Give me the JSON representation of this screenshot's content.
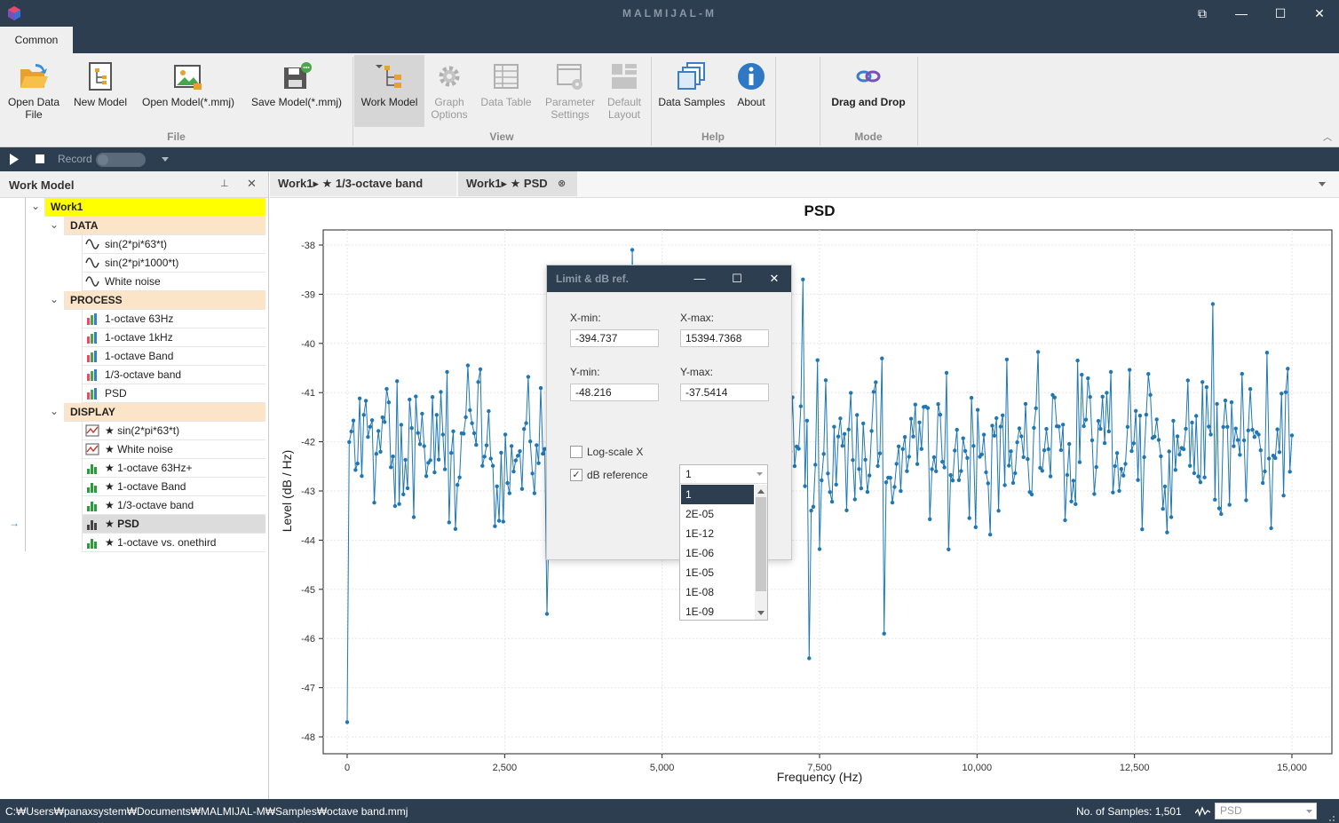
{
  "window": {
    "title": "MALMIJAL-M",
    "controls": {
      "restore_docked": "⧉",
      "minimize": "—",
      "maximize": "☐",
      "close": "✕"
    }
  },
  "ribbon": {
    "tab": "Common",
    "groups": {
      "file": {
        "label": "File",
        "buttons": [
          {
            "label": "Open Data\nFile",
            "icon": "folder-open-icon"
          },
          {
            "label": "New Model",
            "icon": "new-model-icon"
          },
          {
            "label": "Open Model(*.mmj)",
            "icon": "open-model-icon"
          },
          {
            "label": "Save Model(*.mmj)",
            "icon": "save-model-icon"
          }
        ]
      },
      "view": {
        "label": "View",
        "buttons": [
          {
            "label": "Work Model",
            "icon": "tree-icon",
            "active": true
          },
          {
            "label": "Graph\nOptions",
            "icon": "gear-icon",
            "disabled": true
          },
          {
            "label": "Data Table",
            "icon": "table-icon",
            "disabled": true
          },
          {
            "label": "Parameter\nSettings",
            "icon": "settings-window-icon",
            "disabled": true
          },
          {
            "label": "Default\nLayout",
            "icon": "layout-icon",
            "disabled": true
          }
        ]
      },
      "help": {
        "label": "Help",
        "buttons": [
          {
            "label": "Data Samples",
            "icon": "samples-icon"
          },
          {
            "label": "About",
            "icon": "info-icon"
          }
        ]
      },
      "mode": {
        "label": "Mode",
        "buttons": [
          {
            "label": "Drag and Drop",
            "icon": "drag-drop-icon"
          }
        ]
      }
    }
  },
  "toolbar": {
    "record_label": "Record"
  },
  "work_model": {
    "title": "Work Model",
    "root": "Work1",
    "groups": [
      {
        "label": "DATA",
        "items": [
          "sin(2*pi*63*t)",
          "sin(2*pi*1000*t)",
          "White noise"
        ]
      },
      {
        "label": "PROCESS",
        "items": [
          "1-octave 63Hz",
          "1-octave 1kHz",
          "1-octave Band",
          "1/3-octave band",
          "PSD"
        ]
      },
      {
        "label": "DISPLAY",
        "items": [
          "★ sin(2*pi*63*t)",
          "★ White noise",
          "★ 1-octave 63Hz+",
          "★ 1-octave Band",
          "★ 1/3-octave band",
          "★ PSD",
          "★ 1-octave vs. onethird"
        ]
      }
    ]
  },
  "doc_tabs": [
    {
      "label": "Work1▸ ★ 1/3-octave band"
    },
    {
      "label": "Work1▸ ★ PSD",
      "active": true
    }
  ],
  "chart_data": {
    "type": "line",
    "title": "PSD",
    "xlabel": "Frequency (Hz)",
    "ylabel": "Level (dB / Hz)",
    "xlim": [
      0,
      15000
    ],
    "ylim": [
      -48.216,
      -37.5414
    ],
    "xticks": [
      "0",
      "2,500",
      "5,000",
      "7,500",
      "10,000",
      "12,500",
      "15,000"
    ],
    "yticks": [
      "-38",
      "-39",
      "-40",
      "-41",
      "-42",
      "-43",
      "-44",
      "-45",
      "-46",
      "-47",
      "-48"
    ],
    "series": [
      {
        "color": "#1f77b4",
        "points_approx": 1501,
        "x_step": 10,
        "first_value": -47.7,
        "notable": [
          {
            "x": 4540,
            "y": -38.1
          },
          {
            "x": 7220,
            "y": -38.7
          },
          {
            "x": 7350,
            "y": -46.4
          },
          {
            "x": 8530,
            "y": -45.9
          },
          {
            "x": 3180,
            "y": -45.5
          },
          {
            "x": 13740,
            "y": -39.2
          }
        ],
        "typical_range": [
          -44.5,
          -39.8
        ]
      }
    ],
    "grid": true
  },
  "dialog": {
    "title": "Limit & dB ref.",
    "xmin_label": "X-min:",
    "xmin_value": "-394.737",
    "xmax_label": "X-max:",
    "xmax_value": "15394.7368",
    "ymin_label": "Y-min:",
    "ymin_value": "-48.216",
    "ymax_label": "Y-max:",
    "ymax_value": "-37.5414",
    "logx_label": "Log-scale X",
    "logx_checked": false,
    "dbref_label": "dB reference",
    "dbref_checked": true,
    "dbref_value": "1",
    "dbref_options": [
      "1",
      "2E-05",
      "1E-12",
      "1E-06",
      "1E-05",
      "1E-08",
      "1E-09"
    ]
  },
  "status": {
    "path": "C:₩Users₩panaxsystem₩Documents₩MALMIJAL-M₩Samples₩octave band.mmj",
    "samples": "No. of Samples: 1,501",
    "display_select": "PSD"
  },
  "colors": {
    "chrome": "#2d3e50",
    "series": "#1f77b4",
    "root_highlight": "#ffff00",
    "group_highlight": "#fce4c8"
  }
}
